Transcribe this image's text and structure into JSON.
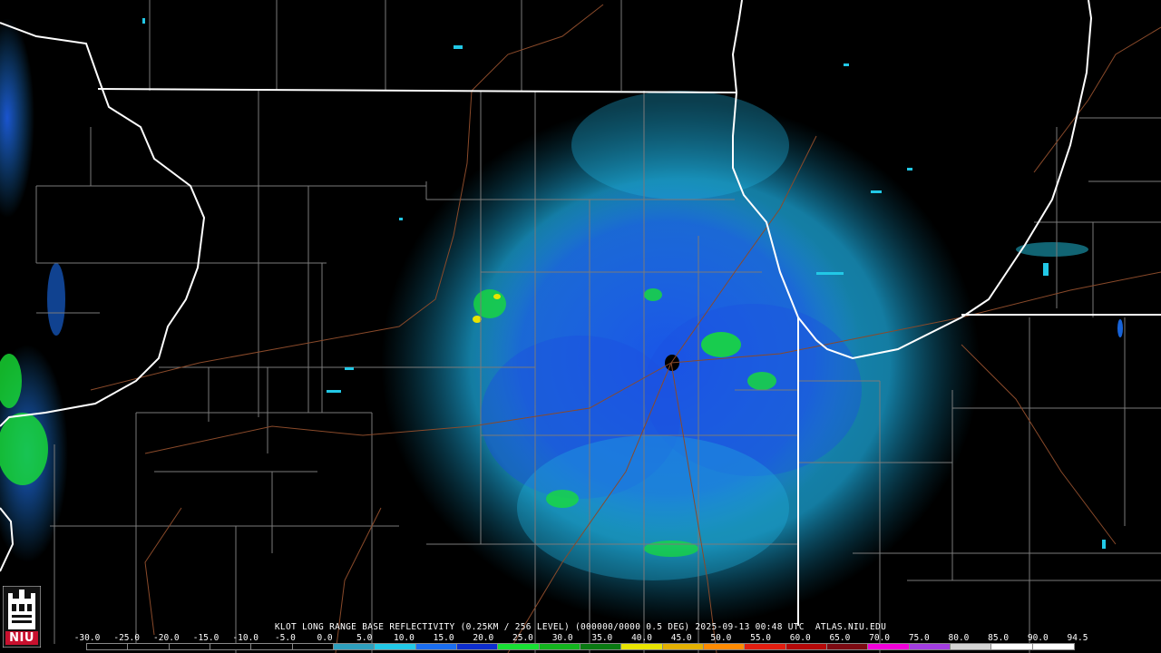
{
  "product": {
    "caption": "KLOT LONG RANGE BASE REFLECTIVITY (0.25KM / 256 LEVEL) (000000/0000 0.5 DEG) 2025-09-13 00:48 UTC  ATLAS.NIU.EDU"
  },
  "logo": {
    "text": "NIU",
    "icon": "niu-castle-logo"
  },
  "color_scale": {
    "labels": [
      "-30.0",
      "-25.0",
      "-20.0",
      "-15.0",
      "-10.0",
      "-5.0",
      "0.0",
      "5.0",
      "10.0",
      "15.0",
      "20.0",
      "25.0",
      "30.0",
      "35.0",
      "40.0",
      "45.0",
      "50.0",
      "55.0",
      "60.0",
      "65.0",
      "70.0",
      "75.0",
      "80.0",
      "85.0",
      "90.0",
      "94.5"
    ],
    "colors": [
      "#000000",
      "#000000",
      "#000000",
      "#000000",
      "#000000",
      "#000000",
      "#2e9fbd",
      "#22c8e6",
      "#1a6ef0",
      "#0d2ecf",
      "#18e034",
      "#13b41e",
      "#0a7a12",
      "#e8e400",
      "#e3b000",
      "#ff8a00",
      "#e21d0f",
      "#b50808",
      "#7d0a12",
      "#f000d8",
      "#a23de0",
      "#d4d4d4",
      "#ffffff",
      "#ffffff"
    ]
  },
  "colors": {
    "background": "#000000",
    "state_borders": "#ffffff",
    "county_borders": "#7a7a7a",
    "highways": "#8a4a2a",
    "echo_light_cyan": "#22c8e6",
    "echo_blue": "#1a6ef0",
    "echo_deep_blue": "#0d2ecf",
    "echo_green": "#18e034",
    "echo_yellow": "#e8e400"
  }
}
